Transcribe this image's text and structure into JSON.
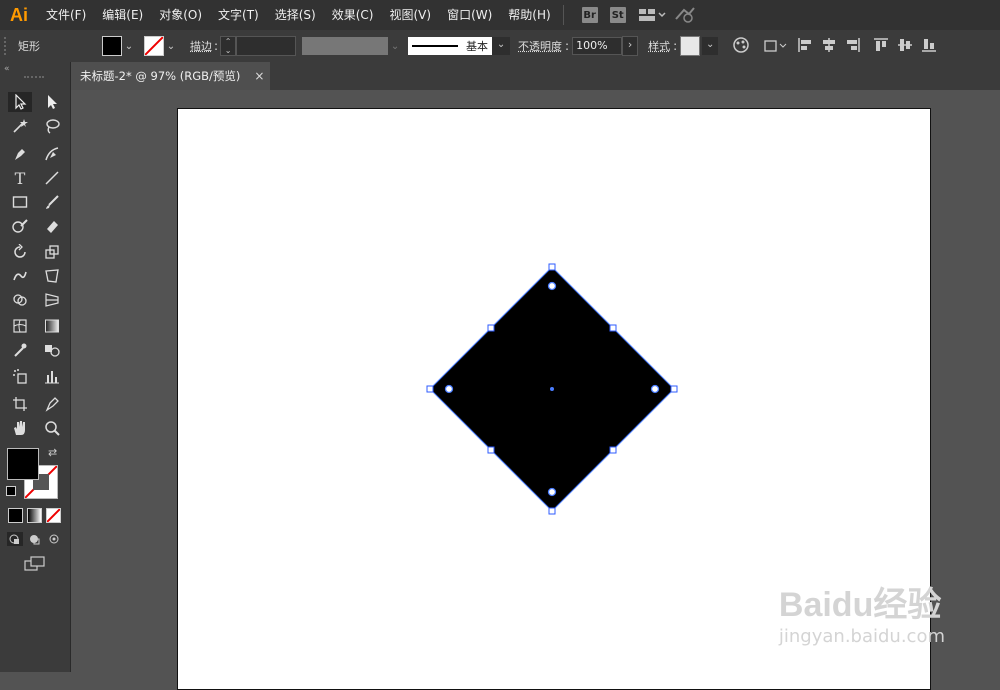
{
  "app": {
    "logo": "Ai"
  },
  "menu": [
    "文件(F)",
    "编辑(E)",
    "对象(O)",
    "文字(T)",
    "选择(S)",
    "效果(C)",
    "视图(V)",
    "窗口(W)",
    "帮助(H)"
  ],
  "bridge": {
    "br": "Br",
    "st": "St"
  },
  "control": {
    "object_type": "矩形",
    "stroke_label": "描边",
    "stroke_profile": "基本",
    "opacity_label": "不透明度",
    "opacity_value": "100%",
    "style_label": "样式"
  },
  "document_tab": {
    "title": "未标题-2* @ 97% (RGB/预览)",
    "close": "×"
  },
  "watermark": {
    "brand": "Baidu经验",
    "url": "jingyan.baidu.com"
  },
  "colors": {
    "fill": "#000000",
    "stroke": "none",
    "selection": "#4a7dff",
    "accent": "#ff9a00"
  }
}
